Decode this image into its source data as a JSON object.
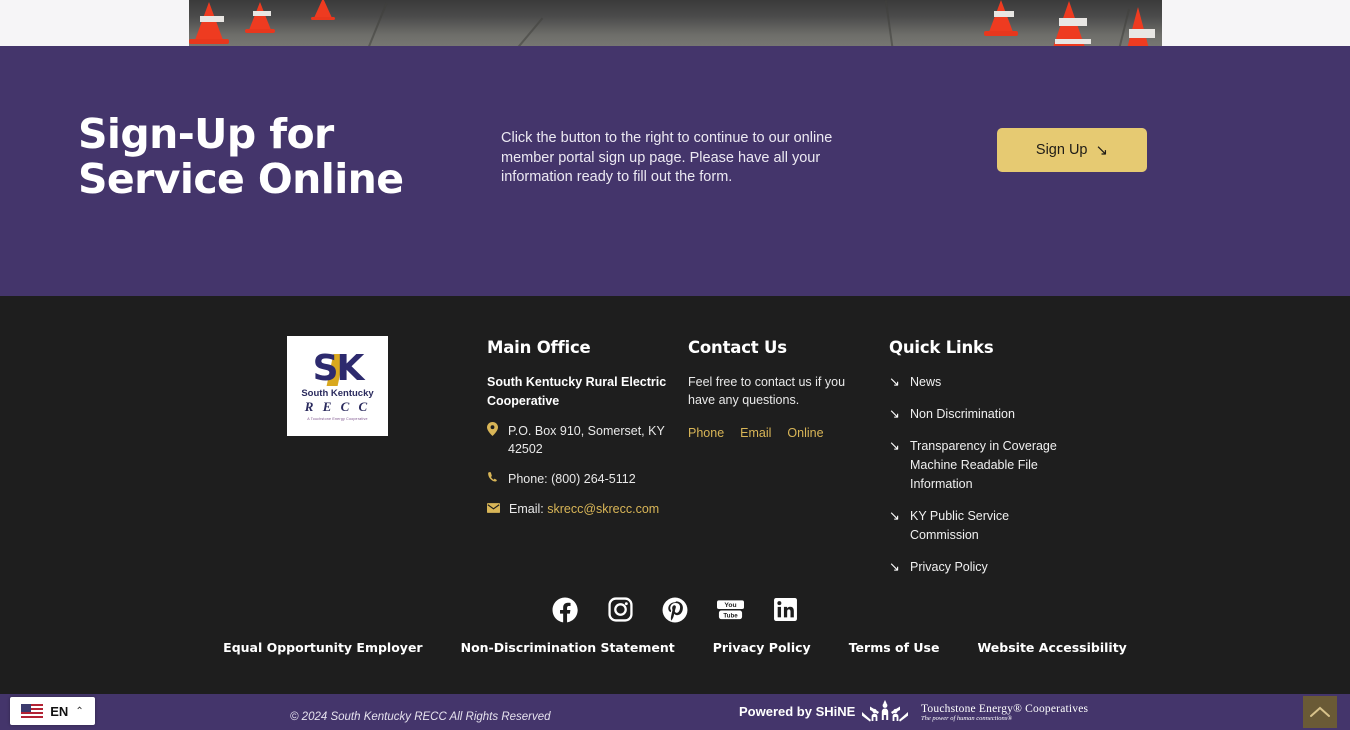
{
  "hero": {
    "image_alt": "traffic-cones-on-asphalt"
  },
  "cta": {
    "title": "Sign-Up for Service Online",
    "description": "Click the button to the right to continue to our online member portal sign up page. Please have all your information ready to fill out the form.",
    "button_label": "Sign Up",
    "button_arrow": "↘",
    "background_color": "#44356b",
    "button_color": "#e6ca72"
  },
  "logo": {
    "mark": "SK",
    "name": "South Kentucky",
    "abbrev": "R E C C",
    "tagline": "A Touchstone Energy Cooperative"
  },
  "footer": {
    "main_office": {
      "heading": "Main Office",
      "org_name": "South Kentucky Rural Electric Cooperative",
      "address": "P.O. Box 910, Somerset, KY 42502",
      "phone": "Phone: (800) 264-5112",
      "email_label": "Email:",
      "email": "skrecc@skrecc.com"
    },
    "contact_us": {
      "heading": "Contact Us",
      "description": "Feel free to contact us if you have any questions.",
      "links": [
        "Phone",
        "Email",
        "Online"
      ]
    },
    "quick_links": {
      "heading": "Quick Links",
      "items": [
        "News",
        "Non Discrimination",
        "Transparency in Coverage Machine Readable File Information",
        "KY Public Service Commission",
        "Privacy Policy"
      ]
    },
    "social": [
      {
        "name": "facebook-icon",
        "label": "Facebook"
      },
      {
        "name": "instagram-icon",
        "label": "Instagram"
      },
      {
        "name": "pinterest-icon",
        "label": "Pinterest"
      },
      {
        "name": "youtube-icon",
        "label": "YouTube"
      },
      {
        "name": "linkedin-icon",
        "label": "LinkedIn"
      }
    ],
    "bottom_links": [
      "Equal Opportunity Employer",
      "Non-Discrimination Statement",
      "Privacy Policy",
      "Terms of Use",
      "Website Accessibility"
    ],
    "background_color": "#1e1e1e",
    "accent_color": "#d8b557"
  },
  "bottom_bar": {
    "copyright": "© 2024 South Kentucky RECC All Rights Reserved",
    "powered_by": "Powered by SHiNE",
    "touchstone_title": "Touchstone Energy® Cooperatives",
    "touchstone_tagline": "The power of human connections®"
  },
  "language_widget": {
    "code": "EN",
    "caret": "⌃",
    "flag": "us-flag-icon"
  },
  "back_to_top": {
    "label": "Back to top"
  }
}
